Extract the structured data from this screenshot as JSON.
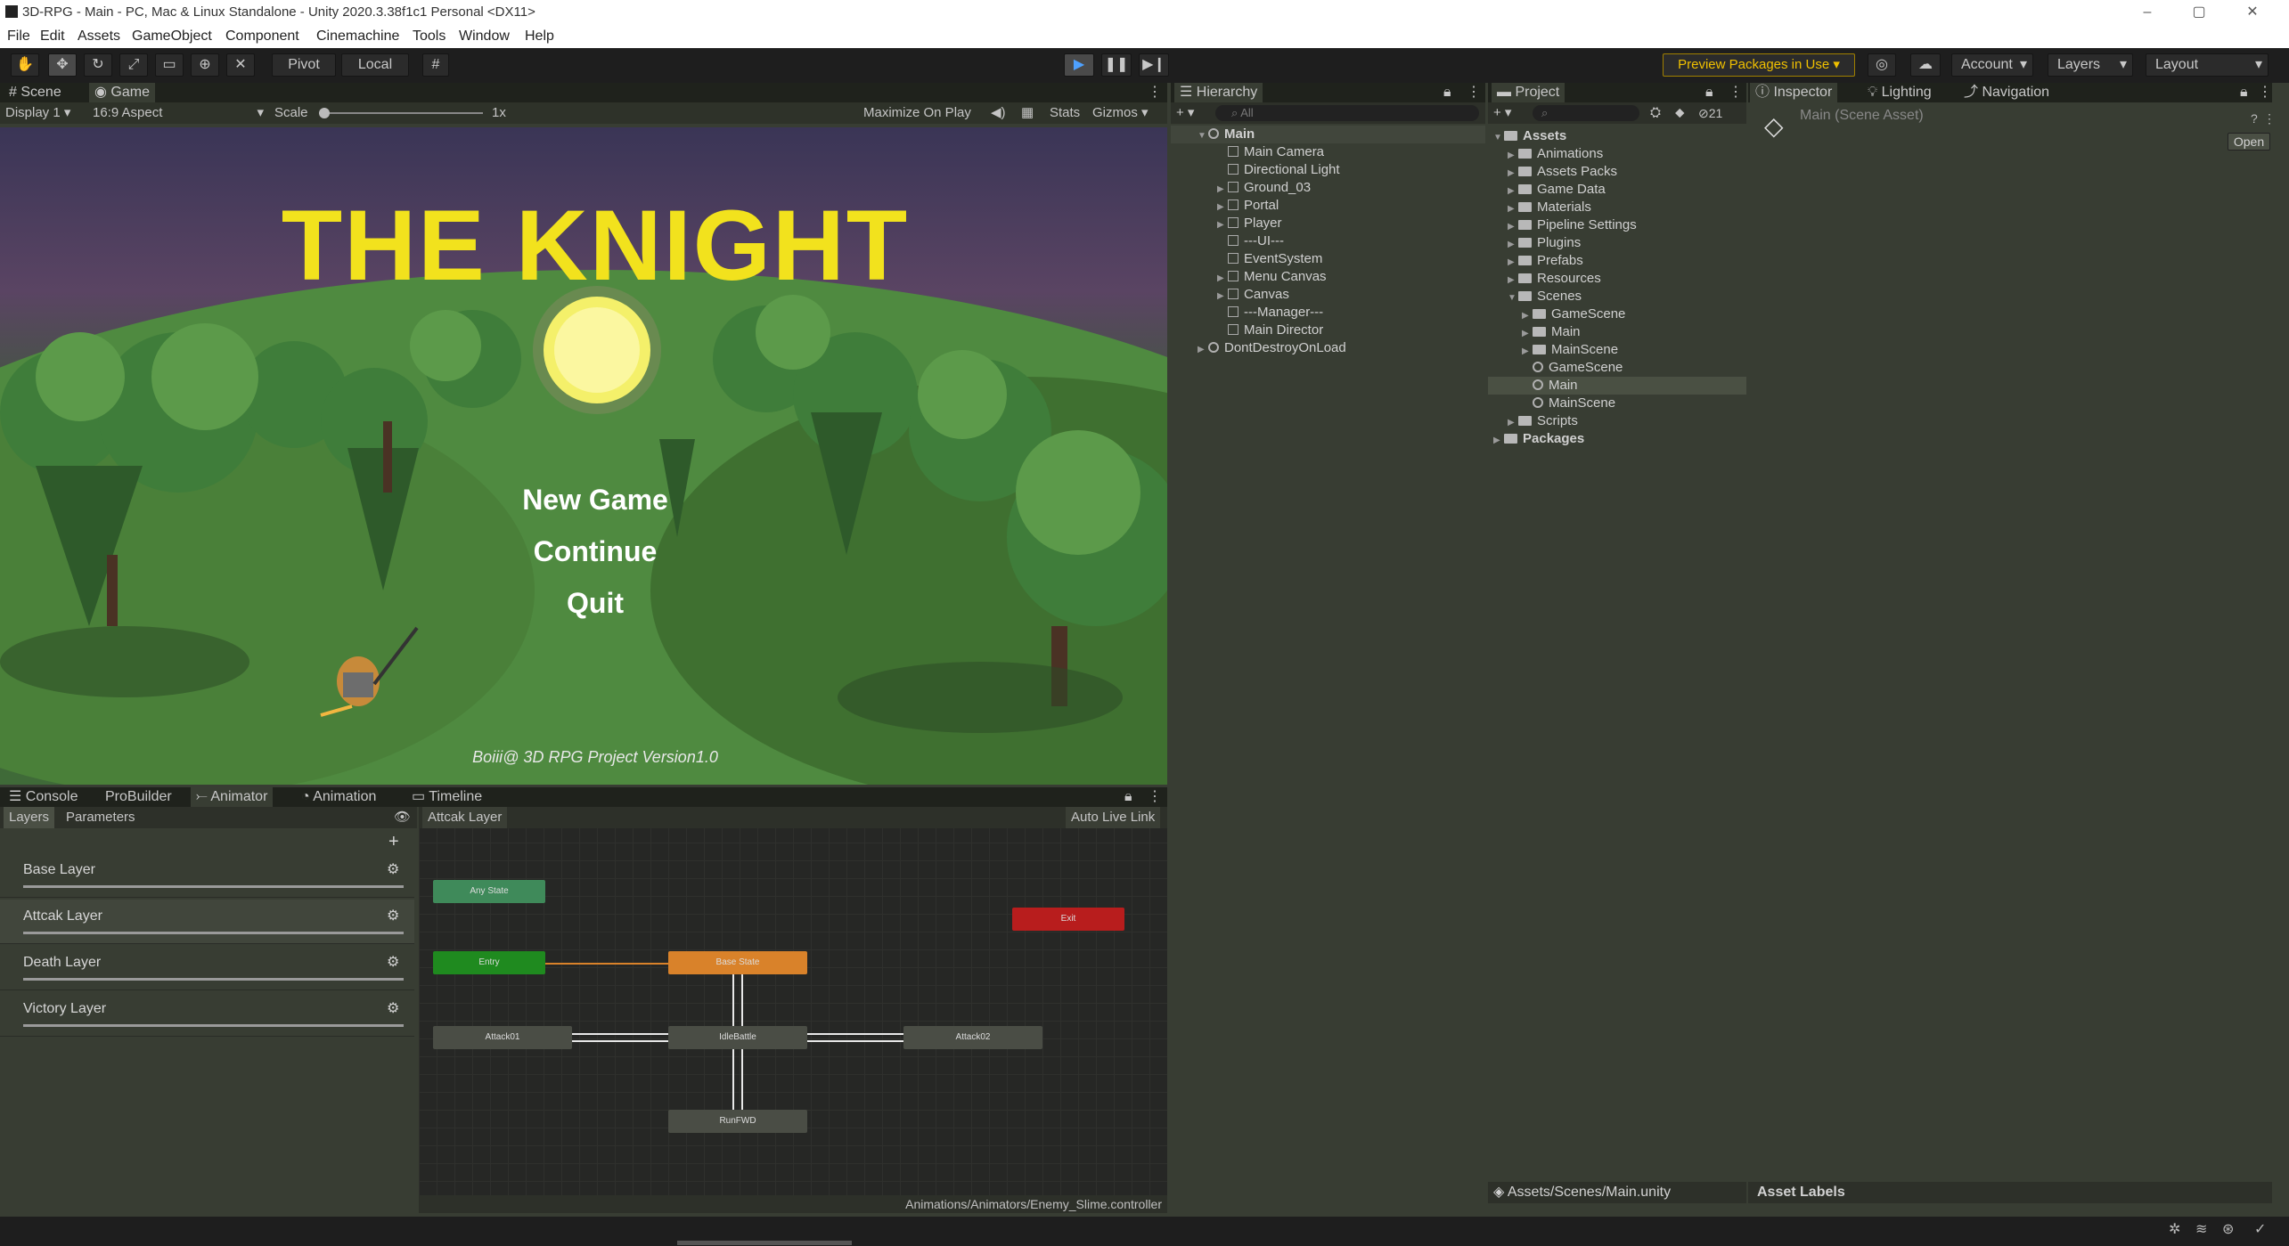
{
  "window": {
    "title": "3D-RPG - Main - PC, Mac & Linux Standalone - Unity 2020.3.38f1c1 Personal <DX11>",
    "minimize": "–",
    "maximize": "▢",
    "close": "✕"
  },
  "menu": [
    "File",
    "Edit",
    "Assets",
    "GameObject",
    "Component",
    "Cinemachine",
    "Tools",
    "Window",
    "Help"
  ],
  "toolbar": {
    "pivot": "Pivot",
    "local": "Local",
    "preview_packages": "Preview Packages in Use ▾",
    "account": "Account",
    "layers": "Layers",
    "layout": "Layout"
  },
  "game_panel": {
    "tabs": [
      "Scene",
      "Game"
    ],
    "display": "Display 1",
    "aspect": "16:9 Aspect",
    "scale_label": "Scale",
    "scale_value": "1x",
    "maximize": "Maximize On Play",
    "stats": "Stats",
    "gizmos": "Gizmos",
    "title": "THE KNIGHT",
    "options": [
      "New Game",
      "Continue",
      "Quit"
    ],
    "footer": "Boiii@ 3D RPG Project Version1.0"
  },
  "hierarchy": {
    "tab": "Hierarchy",
    "search_placeholder": "All",
    "items": [
      {
        "label": "Main",
        "level": 0,
        "expand": "▼",
        "bold": true
      },
      {
        "label": "Main Camera",
        "level": 1,
        "expand": ""
      },
      {
        "label": "Directional Light",
        "level": 1,
        "expand": ""
      },
      {
        "label": "Ground_03",
        "level": 1,
        "expand": "▶"
      },
      {
        "label": "Portal",
        "level": 1,
        "expand": "▶"
      },
      {
        "label": "Player",
        "level": 1,
        "expand": "▶"
      },
      {
        "label": "---UI---",
        "level": 1,
        "expand": ""
      },
      {
        "label": "EventSystem",
        "level": 1,
        "expand": ""
      },
      {
        "label": "Menu Canvas",
        "level": 1,
        "expand": "▶"
      },
      {
        "label": "Canvas",
        "level": 1,
        "expand": "▶"
      },
      {
        "label": "---Manager---",
        "level": 1,
        "expand": ""
      },
      {
        "label": "Main Director",
        "level": 1,
        "expand": ""
      },
      {
        "label": "DontDestroyOnLoad",
        "level": 0,
        "expand": "▶"
      }
    ]
  },
  "project": {
    "tab": "Project",
    "count": "21",
    "items": [
      {
        "label": "Assets",
        "level": 0,
        "type": "folder",
        "expand": "▼",
        "bold": true
      },
      {
        "label": "Animations",
        "level": 1,
        "type": "folder",
        "expand": "▶"
      },
      {
        "label": "Assets Packs",
        "level": 1,
        "type": "folder",
        "expand": "▶"
      },
      {
        "label": "Game Data",
        "level": 1,
        "type": "folder",
        "expand": "▶"
      },
      {
        "label": "Materials",
        "level": 1,
        "type": "folder",
        "expand": "▶"
      },
      {
        "label": "Pipeline Settings",
        "level": 1,
        "type": "folder",
        "expand": "▶"
      },
      {
        "label": "Plugins",
        "level": 1,
        "type": "folder",
        "expand": "▶"
      },
      {
        "label": "Prefabs",
        "level": 1,
        "type": "folder",
        "expand": "▶"
      },
      {
        "label": "Resources",
        "level": 1,
        "type": "folder",
        "expand": "▶"
      },
      {
        "label": "Scenes",
        "level": 1,
        "type": "folder",
        "expand": "▼"
      },
      {
        "label": "GameScene",
        "level": 2,
        "type": "folder",
        "expand": "▶"
      },
      {
        "label": "Main",
        "level": 2,
        "type": "folder",
        "expand": "▶"
      },
      {
        "label": "MainScene",
        "level": 2,
        "type": "folder",
        "expand": "▶"
      },
      {
        "label": "GameScene",
        "level": 2,
        "type": "scene",
        "expand": ""
      },
      {
        "label": "Main",
        "level": 2,
        "type": "scene",
        "expand": "",
        "selected": true
      },
      {
        "label": "MainScene",
        "level": 2,
        "type": "scene",
        "expand": ""
      },
      {
        "label": "Scripts",
        "level": 1,
        "type": "folder",
        "expand": "▶"
      },
      {
        "label": "Packages",
        "level": 0,
        "type": "folder",
        "expand": "▶",
        "bold": true
      }
    ],
    "path": "Assets/Scenes/Main.unity"
  },
  "inspector": {
    "tabs": [
      "Inspector",
      "Lighting",
      "Navigation"
    ],
    "asset_name": "Main (Scene Asset)",
    "open": "Open",
    "asset_labels": "Asset Labels"
  },
  "bottom": {
    "tabs": [
      "Console",
      "ProBuilder",
      "Animator",
      "Animation",
      "Timeline"
    ],
    "sub_tabs": [
      "Layers",
      "Parameters"
    ],
    "breadcrumb": "Attcak Layer",
    "auto_live": "Auto Live Link",
    "layers": [
      "Base Layer",
      "Attcak Layer",
      "Death Layer",
      "Victory Layer"
    ],
    "nodes": {
      "any_state": "Any State",
      "entry": "Entry",
      "exit": "Exit",
      "base_state": "Base State",
      "attack01": "Attack01",
      "idle": "IdleBattle",
      "attack02": "Attack02",
      "run": "RunFWD"
    },
    "controller_path": "Animations/Animators/Enemy_Slime.controller"
  }
}
